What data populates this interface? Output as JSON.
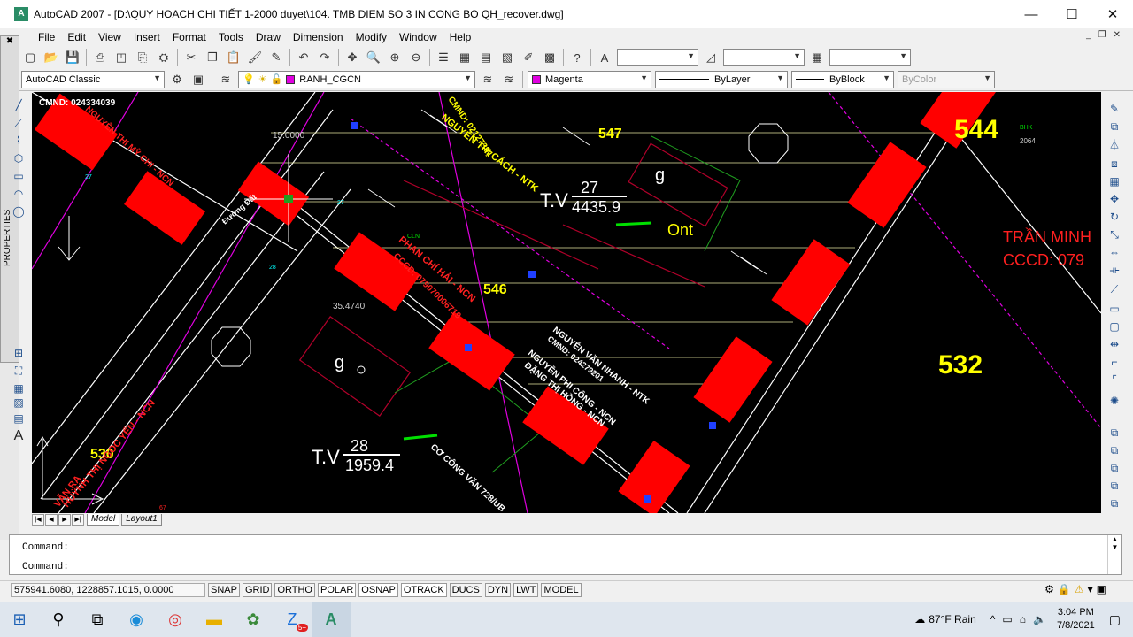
{
  "window": {
    "title": "AutoCAD 2007 - [D:\\QUY HOACH CHI TIẾT 1-2000 duyet\\104. TMB DIEM SO 3 IN CONG BO QH_recover.dwg]",
    "app_icon_text": "A",
    "minimize": "—",
    "maximize": "☐",
    "close": "✕"
  },
  "menu": {
    "items": [
      "File",
      "Edit",
      "View",
      "Insert",
      "Format",
      "Tools",
      "Draw",
      "Dimension",
      "Modify",
      "Window",
      "Help"
    ],
    "mdi": [
      "_",
      "❐",
      "✕"
    ]
  },
  "toolbar1": {
    "icons": [
      "new-icon",
      "open-icon",
      "save-icon",
      "print-icon",
      "preview-icon",
      "publish-icon",
      "plot-icon",
      "cut-icon",
      "copy-icon",
      "paste-icon",
      "match-icon",
      "undo-icon",
      "redo-icon",
      "pan-icon",
      "zoom-rt-icon",
      "zoom-window-icon",
      "zoom-prev-icon",
      "properties-icon",
      "designcenter-icon",
      "toolpalette-icon",
      "sheetset-icon",
      "markup-icon",
      "calc-icon",
      "help-icon"
    ],
    "text_style": "",
    "dim_style": "",
    "table_style": ""
  },
  "toolbar2": {
    "workspace": "AutoCAD Classic",
    "layer": "RANH_CGCN",
    "color_name": "Magenta",
    "color_swatch": "#e000e0",
    "linetype": "ByLayer",
    "lineweight": "ByBlock",
    "plotstyle": "ByColor"
  },
  "palette": {
    "label": "PROPERTIES"
  },
  "drawing": {
    "labels": {
      "n544": "544",
      "n532": "532",
      "n547": "547",
      "n546": "546",
      "n530": "530",
      "tv1_prefix": "T.V",
      "tv1_num": "27",
      "tv1_den": "4435.9",
      "tv2_prefix": "T.V",
      "tv2_num": "28",
      "tv2_den": "1959.4",
      "ont": "Ont",
      "g1": "g",
      "g2": "g",
      "dim1": "15.0000",
      "dim2": "35.4740",
      "owner_name": "TRẦN MINH",
      "owner_id": "CCCD: 079",
      "cmnd": "CMND: 024334039",
      "thi_cach": "NGUYỄN THỊ CÁCH - NTK",
      "thi_cach_id": "CMND: 02127391",
      "phan_chi": "PHAN CHÍ HẢI - NCN",
      "phan_chi_id": "CCCD: 079070006719",
      "van_nhanh": "NGUYỄN VĂN NHANH - NTK",
      "van_nhanh_id": "CMND: 024279201",
      "phi_cong": "NGUYỄN PHI CÔNG - NCN",
      "thi_hong": "ĐẶNG THỊ HỒNG - NCN",
      "my_chi": "NGUYỄN THỊ MỸ CHI - NCN",
      "ngoc_ye": "HUỲNH THỊ NGOC YẾN - NCN",
      "cong_van": "CƠ CÔNG VĂN 728/UB",
      "duong_dat": "Đường Đất",
      "van_ra": "VĂN RA",
      "small_27": "27",
      "small_28": "28",
      "small_2064": "2064",
      "small_cln": "CLN",
      "small_bhk": "BHK",
      "small_67": "67"
    }
  },
  "layout_tabs": [
    "Model",
    "Layout1"
  ],
  "command": {
    "line1": "Command:",
    "line2": "Command:"
  },
  "status": {
    "coords": "575941.6080, 1228857.1015, 0.0000",
    "buttons": [
      "SNAP",
      "GRID",
      "ORTHO",
      "POLAR",
      "OSNAP",
      "OTRACK",
      "DUCS",
      "DYN",
      "LWT",
      "MODEL"
    ]
  },
  "taskbar": {
    "weather": "87°F  Rain",
    "time": "3:04 PM",
    "date": "7/8/2021",
    "badge": "5+"
  }
}
